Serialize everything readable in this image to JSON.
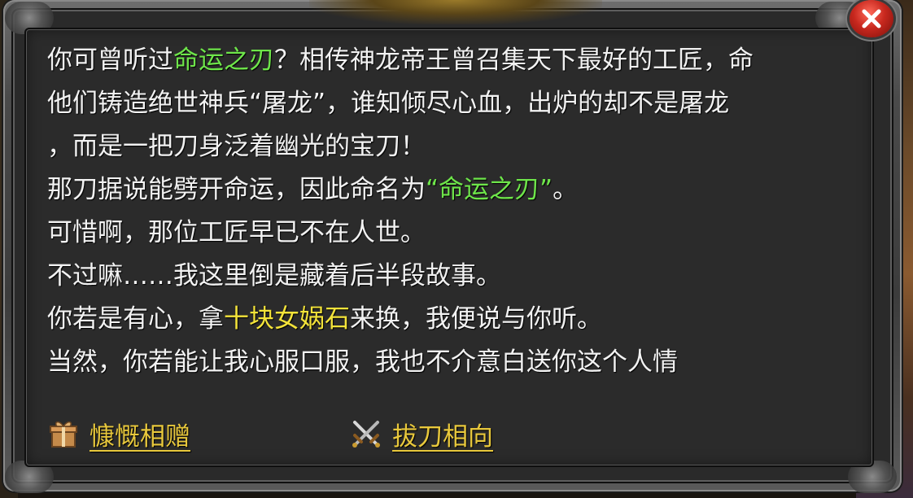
{
  "dialog": {
    "lines": [
      [
        {
          "text": "你可曾听过",
          "color": "white"
        },
        {
          "text": "命运之刃",
          "color": "green"
        },
        {
          "text": "？相传神龙帝王曾召集天下最好的工匠，命",
          "color": "white"
        }
      ],
      [
        {
          "text": "他们铸造绝世神兵“屠龙”，谁知倾尽心血，出炉的却不是屠龙",
          "color": "white"
        }
      ],
      [
        {
          "text": "，而是一把刀身泛着幽光的宝刀！",
          "color": "white"
        }
      ],
      [
        {
          "text": "那刀据说能劈开命运，因此命名为",
          "color": "white"
        },
        {
          "text": "“命运之刃”",
          "color": "green"
        },
        {
          "text": "。",
          "color": "white"
        }
      ],
      [
        {
          "text": "可惜啊，那位工匠早已不在人世。",
          "color": "white"
        }
      ],
      [
        {
          "text": "不过嘛……我这里倒是藏着后半段故事。",
          "color": "white"
        }
      ],
      [
        {
          "text": "你若是有心，拿",
          "color": "white"
        },
        {
          "text": "十块女娲石",
          "color": "yellow"
        },
        {
          "text": "来换，我便说与你听。",
          "color": "white"
        }
      ],
      [
        {
          "text": "当然，你若能让我心服口服，我也不介意白送你这个人情",
          "color": "white"
        }
      ]
    ]
  },
  "options": [
    {
      "label": "慷慨相赠",
      "icon": "gift-icon"
    },
    {
      "label": "拔刀相向",
      "icon": "crossed-swords-icon"
    }
  ],
  "close_button": {
    "icon": "close-icon"
  },
  "colors": {
    "text": "#f2f2f2",
    "highlight_green": "#6ee54a",
    "highlight_yellow": "#f3e33a",
    "option_text": "#e8c83c",
    "close_red": "#c8281e"
  }
}
